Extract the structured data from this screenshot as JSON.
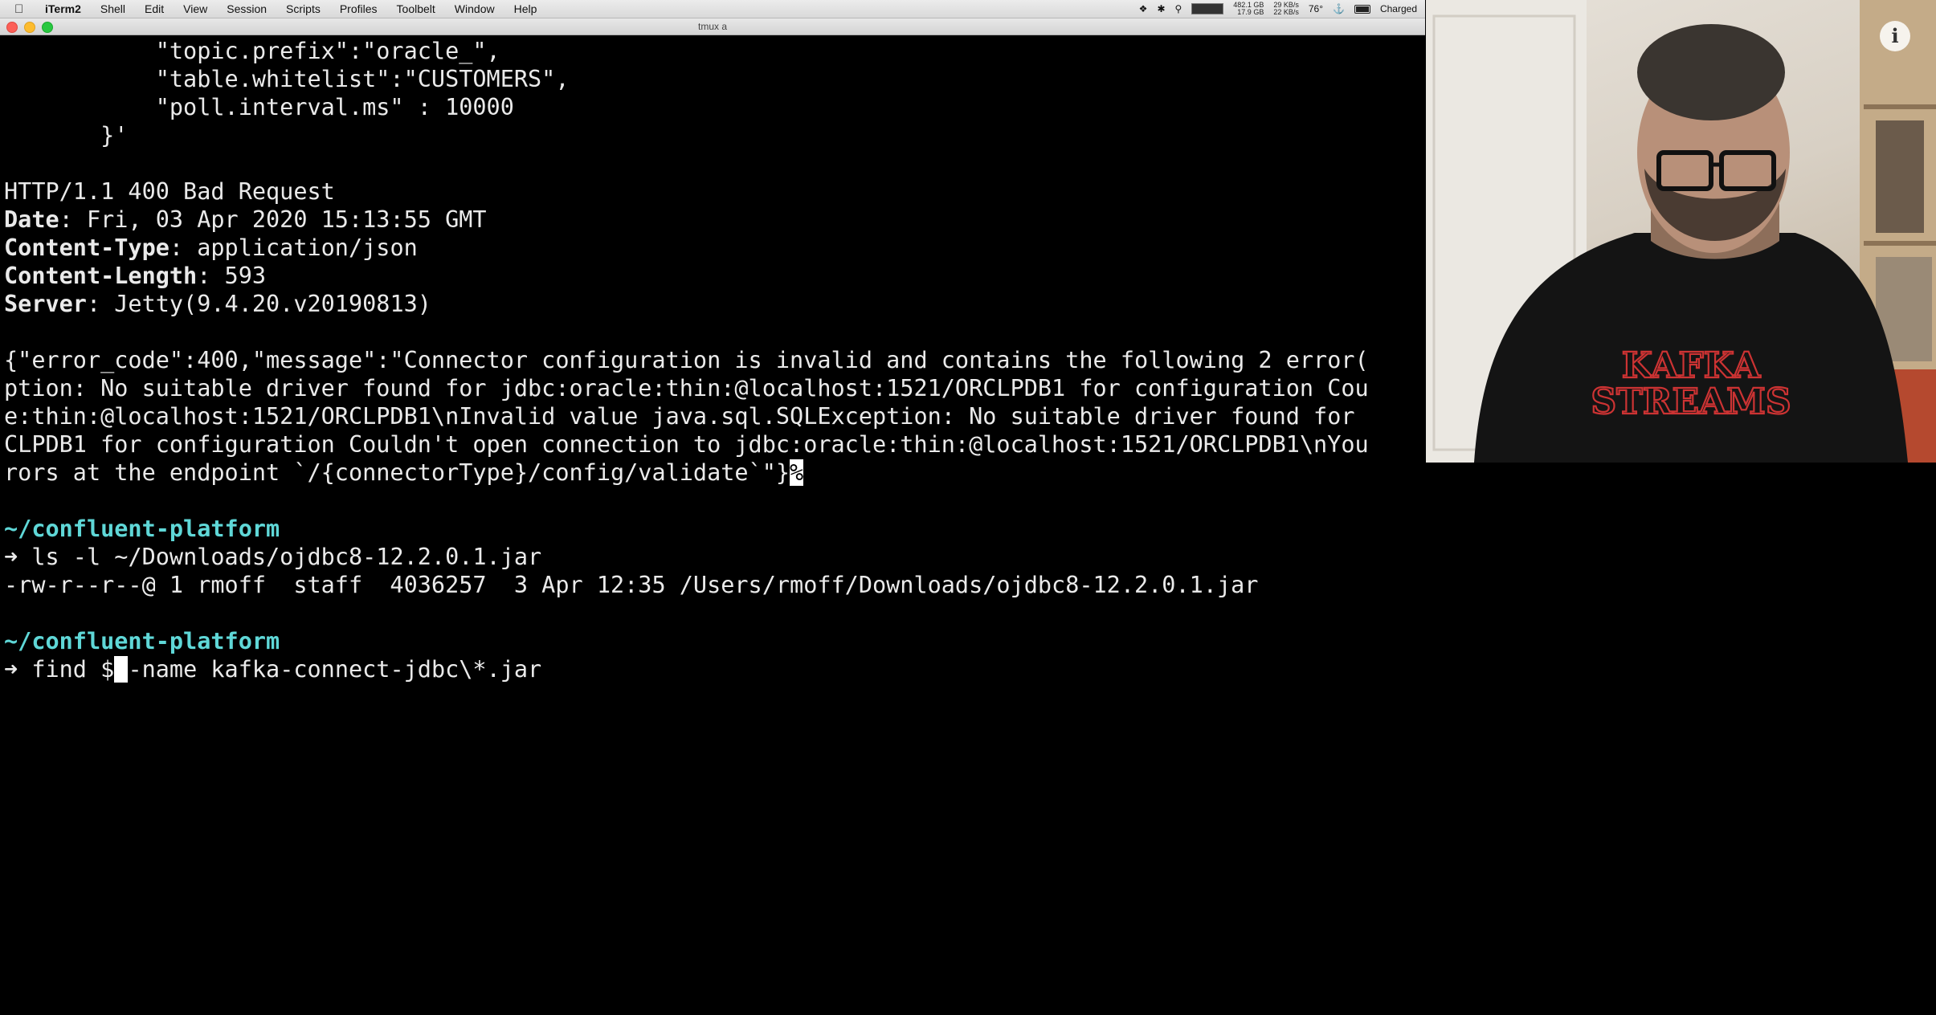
{
  "menubar": {
    "app_name": "iTerm2",
    "menus": [
      "Shell",
      "Edit",
      "View",
      "Session",
      "Scripts",
      "Profiles",
      "Toolbelt",
      "Window",
      "Help"
    ],
    "status": {
      "mem_top": "482.1 GB",
      "mem_bottom": "17.9 GB",
      "net_top": "29 KB/s",
      "net_bottom": "22 KB/s",
      "temp": "76°",
      "battery": "Charged"
    }
  },
  "window": {
    "title": "tmux a"
  },
  "terminal": {
    "json_lines": [
      "           \"topic.prefix\":\"oracle_\",",
      "           \"table.whitelist\":\"CUSTOMERS\",",
      "           \"poll.interval.ms\" : 10000",
      "       }'"
    ],
    "status_line": "HTTP/1.1 400 Bad Request",
    "headers": [
      {
        "key": "Date",
        "value": ": Fri, 03 Apr 2020 15:13:55 GMT"
      },
      {
        "key": "Content-Type",
        "value": ": application/json"
      },
      {
        "key": "Content-Length",
        "value": ": 593"
      },
      {
        "key": "Server",
        "value": ": Jetty(9.4.20.v20190813)"
      }
    ],
    "error_lines": [
      "{\"error_code\":400,\"message\":\"Connector configuration is invalid and contains the following 2 error(",
      "ption: No suitable driver found for jdbc:oracle:thin:@localhost:1521/ORCLPDB1 for configuration Cou",
      "e:thin:@localhost:1521/ORCLPDB1\\nInvalid value java.sql.SQLException: No suitable driver found for",
      "CLPDB1 for configuration Couldn't open connection to jdbc:oracle:thin:@localhost:1521/ORCLPDB1\\nYou",
      "rors at the endpoint `/{connectorType}/config/validate`\"}"
    ],
    "error_end_marker": "%",
    "prompt1_dir": "~/confluent-platform",
    "prompt_arrow": "➜",
    "cmd1": " ls -l ~/Downloads/ojdbc8-12.2.0.1.jar",
    "output1": "-rw-r--r--@ 1 rmoff  staff  4036257  3 Apr 12:35 /Users/rmoff/Downloads/ojdbc8-12.2.0.1.jar",
    "prompt2_dir": "~/confluent-platform",
    "cmd2_before_cursor": " find $",
    "cmd2_cursor_char": " ",
    "cmd2_after_cursor": "-name kafka-connect-jdbc\\*.jar"
  },
  "webcam": {
    "shirt_line1": "KAFKA",
    "shirt_line2": "STREAMS"
  }
}
